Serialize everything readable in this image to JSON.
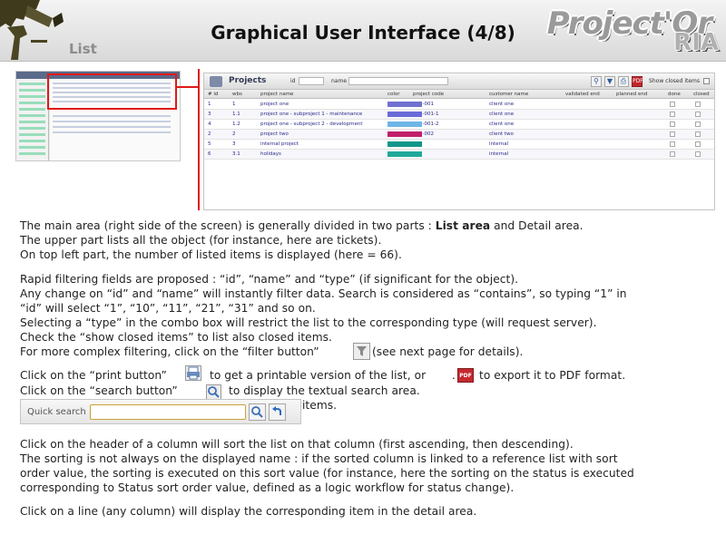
{
  "header": {
    "section": "List",
    "title": "Graphical User Interface (4/8)",
    "brand_main": "Project'Or",
    "brand_sub": "RIA"
  },
  "projects_panel": {
    "title": "Projects",
    "id_label": "id",
    "name_label": "name",
    "show_closed_label": "Show closed items",
    "columns": [
      "# id",
      "wbs",
      "project name",
      "color",
      "project code",
      "customer name",
      "validated end",
      "planned end",
      "done",
      "closed"
    ],
    "rows": [
      {
        "id": "1",
        "wbs": "1",
        "name": "project one",
        "color": "#7070d0",
        "code": "001-001",
        "customer": "client one"
      },
      {
        "id": "3",
        "wbs": "1.1",
        "name": "project one - subproject 1 - maintenance",
        "color": "#6a6ad8",
        "code": "001-001-1",
        "customer": "client one"
      },
      {
        "id": "4",
        "wbs": "1.2",
        "name": "project one - subproject 2 - development",
        "color": "#6db6e6",
        "code": "001-001-2",
        "customer": "client one"
      },
      {
        "id": "2",
        "wbs": "2",
        "name": "project two",
        "color": "#c21f6a",
        "code": "002-002",
        "customer": "client two"
      },
      {
        "id": "5",
        "wbs": "3",
        "name": "internal project",
        "color": "#12968a",
        "code": "",
        "customer": "internal"
      },
      {
        "id": "6",
        "wbs": "3.1",
        "name": "holidays",
        "color": "#21a89a",
        "code": "",
        "customer": "internal"
      }
    ]
  },
  "body": {
    "p1_line1_a": "The main area (right side of the screen) is generally divided in two parts : ",
    "p1_line1_b": "List area",
    "p1_line1_c": " and Detail area.",
    "p1_line2": "The upper part lists all the object (for instance, here are tickets).",
    "p1_line3": "On top left part, the number of listed items is displayed (here = 66).",
    "p2_line1": "Rapid filtering fields are proposed : “id”, “name” and “type” (if significant for the object).",
    "p2_line2": "Any change on “id” and “name” will instantly filter data. Search is considered as “contains”, so typing “1” in",
    "p2_line3": "“id” will select “1”, “10”, “11”, “21”, “31” and so on.",
    "p2_line4": "Selecting a “type” in the combo box will restrict the list to the corresponding type (will request server).",
    "p2_line5": "Check the “show closed items” to list also closed items.",
    "p2_line6_a": "For more complex filtering, click on the “filter button”",
    "p2_line6_b": "(see next page for details).",
    "p3_line1_a": "Click on the “print button”",
    "p3_line1_b": "to get a printable version of the list, or",
    "p3_line1_c": "to export it to PDF format.",
    "p3_line2_a": "Click on the “search button”",
    "p3_line2_b": "to display the textual search area.",
    "p3_line3_tail": "items.",
    "p4_line1": "Click on the header of a column will sort the list on that column (first ascending, then descending).",
    "p4_line2": "The sorting is not always on the displayed name : if the sorted column is linked to a reference list with sort",
    "p4_line3": "order value, the sorting is executed on this sort value (for instance, here the sorting on the status is executed",
    "p4_line4": "corresponding to Status sort order value, defined as a logic workflow for status change).",
    "p5_line1": "Click on a line (any column) will display the corresponding item in the detail area."
  },
  "quick_search": {
    "label": "Quick search",
    "value": ""
  },
  "colors": {
    "highlight": "#e01919"
  }
}
